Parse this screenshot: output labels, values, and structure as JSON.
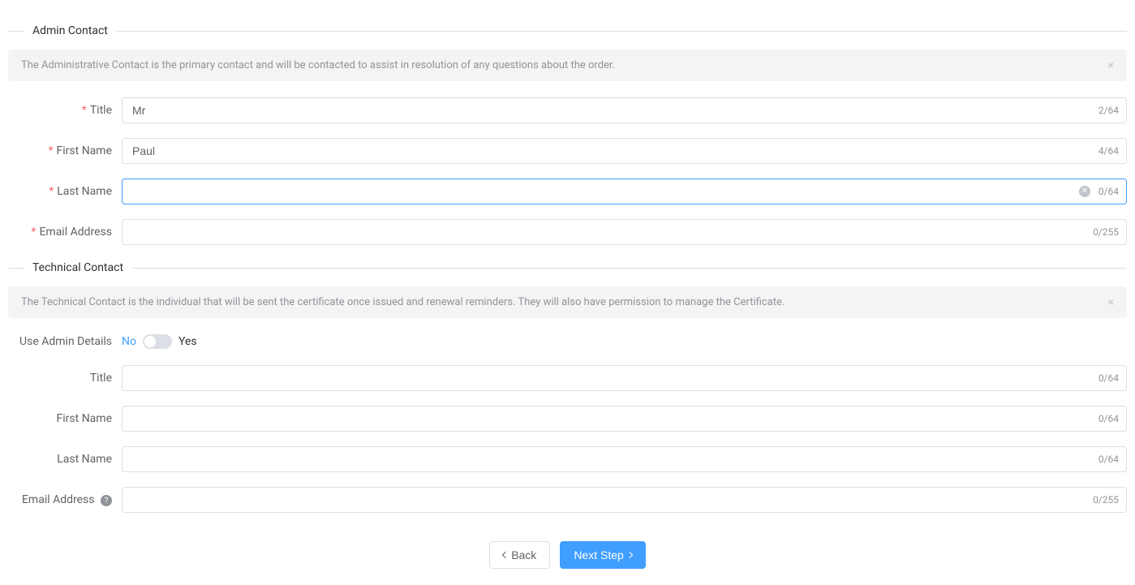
{
  "sections": {
    "admin": {
      "title": "Admin Contact",
      "alert": "The Administrative Contact is the primary contact and will be contacted to assist in resolution of any questions about the order.",
      "fields": {
        "title": {
          "label": "Title",
          "value": "Mr",
          "count": "2/64"
        },
        "firstName": {
          "label": "First Name",
          "value": "Paul",
          "count": "4/64"
        },
        "lastName": {
          "label": "Last Name",
          "value": "",
          "count": "0/64"
        },
        "email": {
          "label": "Email Address",
          "value": "",
          "count": "0/255"
        }
      }
    },
    "technical": {
      "title": "Technical Contact",
      "alert": "The Technical Contact is the individual that will be sent the certificate once issued and renewal reminders. They will also have permission to manage the Certificate.",
      "useAdmin": {
        "label": "Use Admin Details",
        "no": "No",
        "yes": "Yes"
      },
      "fields": {
        "title": {
          "label": "Title",
          "value": "",
          "count": "0/64"
        },
        "firstName": {
          "label": "First Name",
          "value": "",
          "count": "0/64"
        },
        "lastName": {
          "label": "Last Name",
          "value": "",
          "count": "0/64"
        },
        "email": {
          "label": "Email Address",
          "value": "",
          "count": "0/255"
        }
      }
    }
  },
  "buttons": {
    "back": "Back",
    "next": "Next Step"
  }
}
